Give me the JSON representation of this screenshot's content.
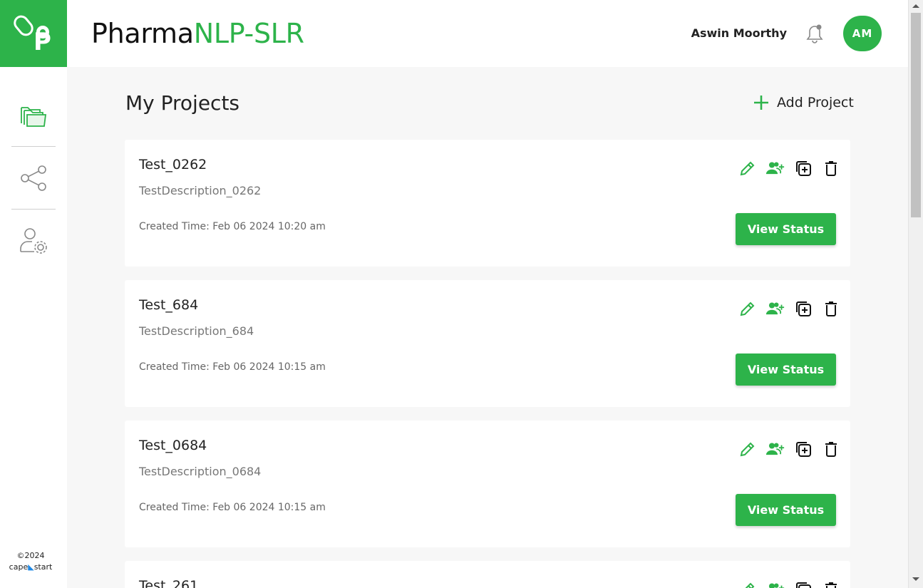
{
  "brand": {
    "logo_letter": "P",
    "title_part1": "Pharma",
    "title_part2": "NLP-SLR",
    "accent_color": "#2db34a"
  },
  "header": {
    "user_name": "Aswin Moorthy",
    "avatar_initials": "AM",
    "bell_icon": "bell-icon"
  },
  "sidebar": {
    "items": [
      {
        "name": "projects",
        "icon": "folders-icon"
      },
      {
        "name": "share",
        "icon": "share-icon"
      },
      {
        "name": "user-settings",
        "icon": "user-gear-icon"
      }
    ],
    "copyright": "©2024",
    "company_left": "cape",
    "company_mark": "◣",
    "company_right": "start"
  },
  "main": {
    "title": "My Projects",
    "add_project_label": "Add Project",
    "projects": [
      {
        "name": "Test_0262",
        "description": "TestDescription_0262",
        "created": "Created Time: Feb 06 2024 10:20 am",
        "button": "View Status"
      },
      {
        "name": "Test_684",
        "description": "TestDescription_684",
        "created": "Created Time: Feb 06 2024 10:15 am",
        "button": "View Status"
      },
      {
        "name": "Test_0684",
        "description": "TestDescription_0684",
        "created": "Created Time: Feb 06 2024 10:15 am",
        "button": "View Status"
      },
      {
        "name": "Test_261",
        "description": "",
        "created": "",
        "button": ""
      }
    ]
  }
}
